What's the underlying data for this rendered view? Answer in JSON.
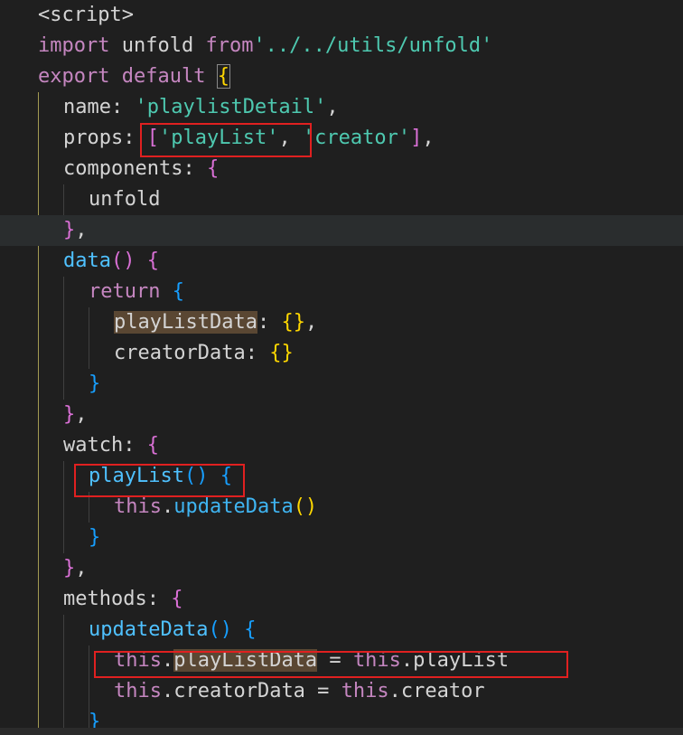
{
  "editor": {
    "lines": [
      [
        {
          "t": "<script>",
          "c": "tag"
        }
      ],
      [
        {
          "t": "import",
          "c": "kw"
        },
        {
          "t": " unfold ",
          "c": "id"
        },
        {
          "t": "from",
          "c": "kw"
        },
        {
          "t": "'../../utils/unfold'",
          "c": "str"
        }
      ],
      [
        {
          "t": "export",
          "c": "kw"
        },
        {
          "t": " ",
          "c": "id"
        },
        {
          "t": "default",
          "c": "kw"
        },
        {
          "t": " ",
          "c": "id"
        },
        {
          "t": "{",
          "c": "p1"
        }
      ],
      [
        {
          "t": "name",
          "c": "prop"
        },
        {
          "t": ": ",
          "c": "punct"
        },
        {
          "t": "'playlistDetail'",
          "c": "str"
        },
        {
          "t": ",",
          "c": "punct"
        }
      ],
      [
        {
          "t": "props",
          "c": "prop"
        },
        {
          "t": ": ",
          "c": "punct"
        },
        {
          "t": "[",
          "c": "p2"
        },
        {
          "t": "'playList'",
          "c": "str"
        },
        {
          "t": ", ",
          "c": "punct"
        },
        {
          "t": "'creator'",
          "c": "str"
        },
        {
          "t": "]",
          "c": "p2"
        },
        {
          "t": ",",
          "c": "punct"
        }
      ],
      [
        {
          "t": "components",
          "c": "prop"
        },
        {
          "t": ": ",
          "c": "punct"
        },
        {
          "t": "{",
          "c": "p2"
        }
      ],
      [
        {
          "t": "unfold",
          "c": "id"
        }
      ],
      [
        {
          "t": "}",
          "c": "p2"
        },
        {
          "t": ",",
          "c": "punct"
        }
      ],
      [
        {
          "t": "data",
          "c": "fn"
        },
        {
          "t": "()",
          "c": "p2"
        },
        {
          "t": " ",
          "c": "id"
        },
        {
          "t": "{",
          "c": "p2"
        }
      ],
      [
        {
          "t": "return",
          "c": "kw"
        },
        {
          "t": " ",
          "c": "id"
        },
        {
          "t": "{",
          "c": "p3"
        }
      ],
      [
        {
          "t": "playListData",
          "c": "prop",
          "hl": true
        },
        {
          "t": ": ",
          "c": "punct"
        },
        {
          "t": "{}",
          "c": "p1"
        },
        {
          "t": ",",
          "c": "punct"
        }
      ],
      [
        {
          "t": "creatorData",
          "c": "prop"
        },
        {
          "t": ": ",
          "c": "punct"
        },
        {
          "t": "{}",
          "c": "p1"
        }
      ],
      [
        {
          "t": "}",
          "c": "p3"
        }
      ],
      [
        {
          "t": "}",
          "c": "p2"
        },
        {
          "t": ",",
          "c": "punct"
        }
      ],
      [
        {
          "t": "watch",
          "c": "prop"
        },
        {
          "t": ": ",
          "c": "punct"
        },
        {
          "t": "{",
          "c": "p2"
        }
      ],
      [
        {
          "t": "playList",
          "c": "fn"
        },
        {
          "t": "()",
          "c": "p3"
        },
        {
          "t": " ",
          "c": "id"
        },
        {
          "t": "{",
          "c": "p3"
        }
      ],
      [
        {
          "t": "this",
          "c": "this"
        },
        {
          "t": ".",
          "c": "punct"
        },
        {
          "t": "updateData",
          "c": "fn2"
        },
        {
          "t": "()",
          "c": "p1"
        }
      ],
      [
        {
          "t": "}",
          "c": "p3"
        }
      ],
      [
        {
          "t": "}",
          "c": "p2"
        },
        {
          "t": ",",
          "c": "punct"
        }
      ],
      [
        {
          "t": "methods",
          "c": "prop"
        },
        {
          "t": ": ",
          "c": "punct"
        },
        {
          "t": "{",
          "c": "p2"
        }
      ],
      [
        {
          "t": "updateData",
          "c": "fn"
        },
        {
          "t": "()",
          "c": "p3"
        },
        {
          "t": " ",
          "c": "id"
        },
        {
          "t": "{",
          "c": "p3"
        }
      ],
      [
        {
          "t": "this",
          "c": "this"
        },
        {
          "t": ".",
          "c": "punct"
        },
        {
          "t": "playListData",
          "c": "prop",
          "hl": true
        },
        {
          "t": " = ",
          "c": "punct"
        },
        {
          "t": "this",
          "c": "this"
        },
        {
          "t": ".",
          "c": "punct"
        },
        {
          "t": "playList",
          "c": "prop"
        }
      ],
      [
        {
          "t": "this",
          "c": "this"
        },
        {
          "t": ".",
          "c": "punct"
        },
        {
          "t": "creatorData",
          "c": "prop"
        },
        {
          "t": " = ",
          "c": "punct"
        },
        {
          "t": "this",
          "c": "this"
        },
        {
          "t": ".",
          "c": "punct"
        },
        {
          "t": "creator",
          "c": "prop"
        }
      ],
      [
        {
          "t": "}",
          "c": "p3"
        }
      ]
    ],
    "colors": {
      "background": "#1f1f1f",
      "current_line": "#2a2d2e",
      "annotation_box": "#e02020"
    }
  }
}
